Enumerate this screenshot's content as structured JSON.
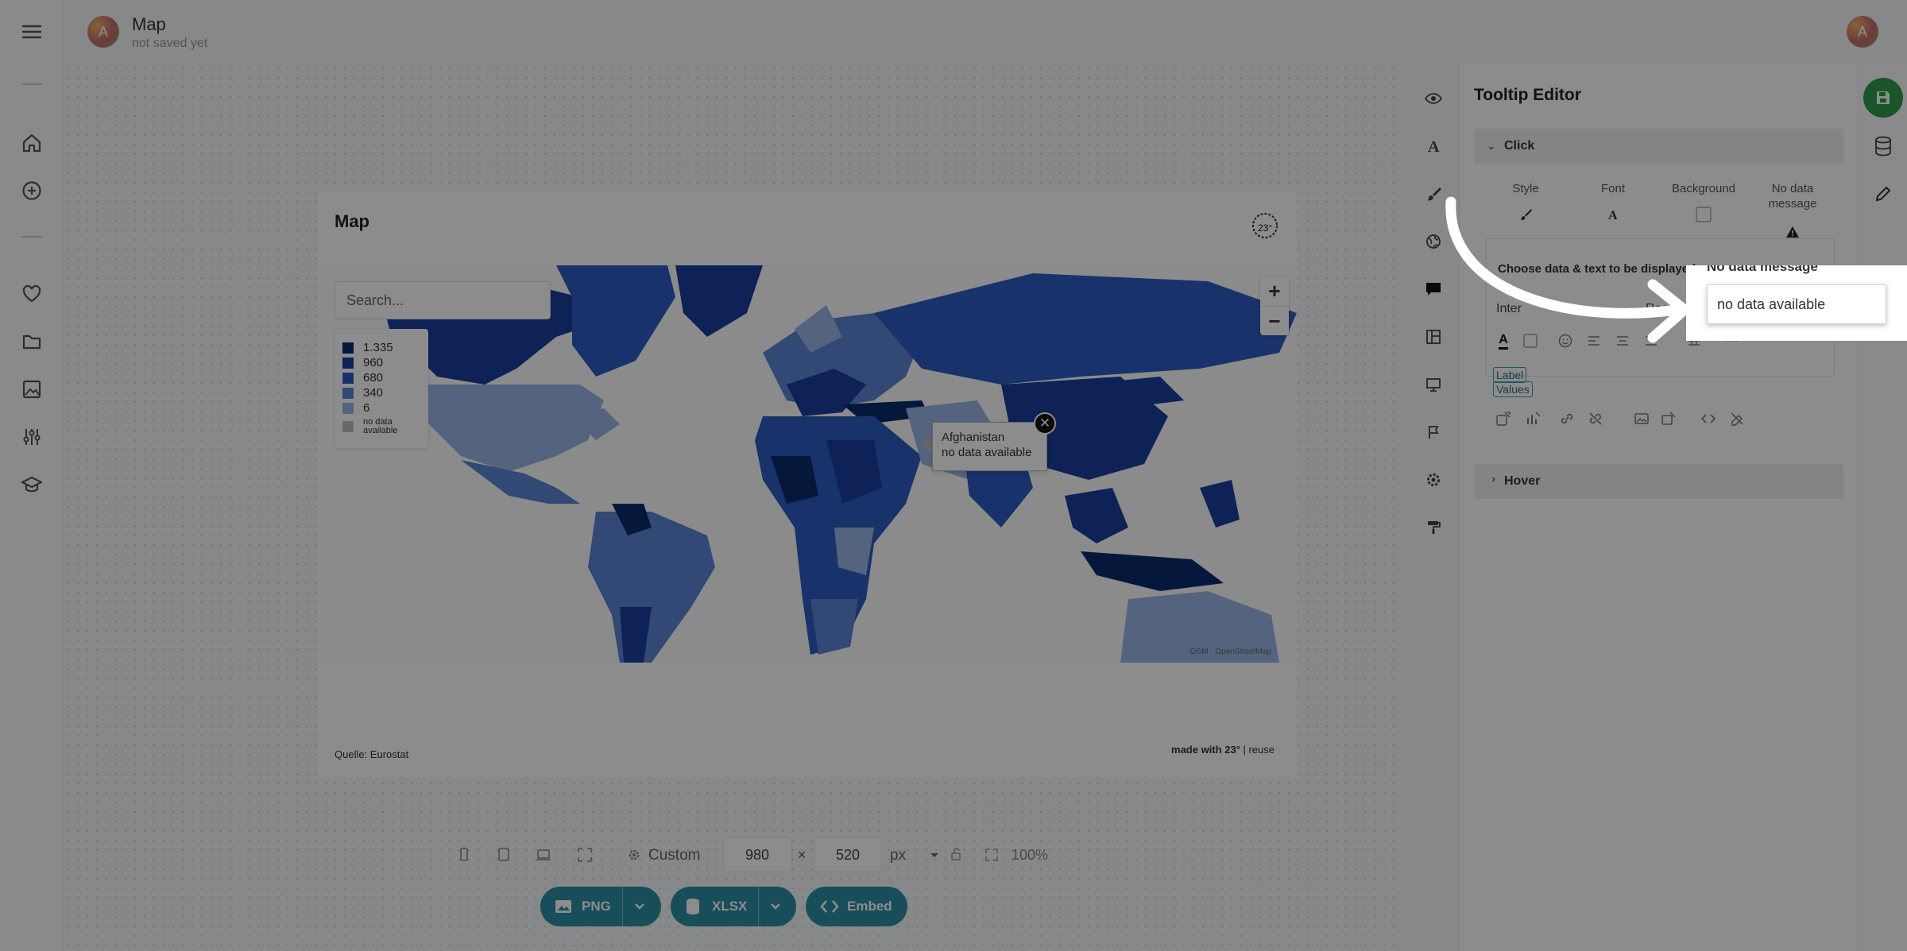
{
  "header": {
    "title": "Map",
    "subtitle": "not saved yet",
    "avatar_letter": "A",
    "user_avatar_letter": "A"
  },
  "map": {
    "title": "Map",
    "search_placeholder": "Search...",
    "legend": [
      {
        "label": "1.335",
        "color": "#0b2a6e"
      },
      {
        "label": "960",
        "color": "#1a3f9e"
      },
      {
        "label": "680",
        "color": "#2d5bc4"
      },
      {
        "label": "340",
        "color": "#5b84d6"
      },
      {
        "label": "6",
        "color": "#9ab7e6"
      },
      {
        "label": "no data available",
        "color": "#bdbdbd"
      }
    ],
    "tooltip": {
      "country": "Afghanistan",
      "value": "no data available"
    },
    "zoom_in": "+",
    "zoom_out": "−",
    "attribution": "OSM · OpenStreetMap",
    "source": "Quelle: Eurostat",
    "made_with": "made with 23°",
    "reuse": "| reuse"
  },
  "toolbar": {
    "size_preset": "Custom",
    "width": "980",
    "height": "520",
    "unit": "px",
    "zoom": "100%",
    "export_png": "PNG",
    "export_xlsx": "XLSX",
    "export_embed": "Embed"
  },
  "panel": {
    "title": "Tooltip Editor",
    "section_click": "Click",
    "section_hover": "Hover",
    "opt_style": "Style",
    "opt_font": "Font",
    "opt_background": "Background",
    "opt_nodata": "No data message",
    "choose_label": "Choose data & text to be displayed",
    "font_name": "Inter",
    "font_weight": "Regular",
    "chip_label": "Label",
    "chip_values": "Values"
  },
  "popup": {
    "header": "No data message",
    "value": "no data available"
  },
  "colors": {
    "accent": "#2c8fa5",
    "save": "#2e9c4b",
    "map_dark": "#0b2a6e",
    "map_light": "#9ab7e6"
  }
}
